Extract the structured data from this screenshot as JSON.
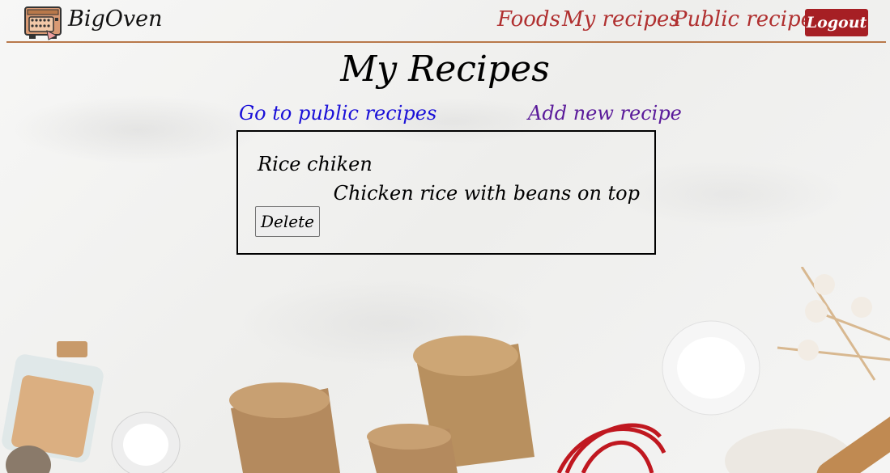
{
  "navbar": {
    "brand": "BigOven",
    "links": [
      "Foods",
      "My recipes",
      "Public recipes"
    ],
    "logout_label": "Logout",
    "accent_color": "#b03030",
    "logout_color": "#a61f24"
  },
  "page": {
    "title": "My Recipes",
    "public_link": "Go to public recipes",
    "add_link": "Add new recipe"
  },
  "recipes": [
    {
      "name": "Rice chiken",
      "description": "Chicken rice with beans on top",
      "delete_label": "Delete"
    }
  ],
  "icons": {
    "logo": "oven-icon"
  }
}
